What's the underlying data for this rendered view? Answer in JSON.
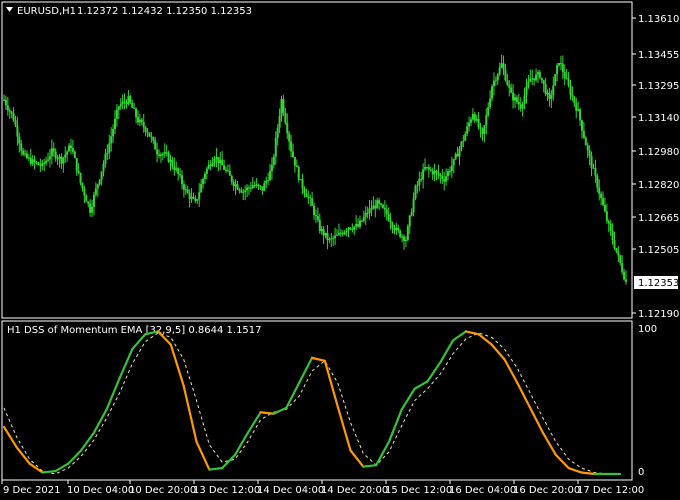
{
  "header": {
    "symbol": "EURUSD,H1",
    "ohlc": "1.12372 1.12432 1.12350 1.12353",
    "menu_icon": "triangle-down-icon"
  },
  "price_axis": {
    "ticks": [
      "1.13610",
      "1.13455",
      "1.13295",
      "1.13140",
      "1.12980",
      "1.12820",
      "1.12665",
      "1.12505",
      "1.12190"
    ],
    "current": "1.12353"
  },
  "indicator": {
    "title": "H1 DSS of Momentum EMA [32,9,5] 0.8644 1.1517",
    "ticks": [
      "100",
      "0"
    ]
  },
  "time_axis": {
    "labels": [
      "9 Dec 2021",
      "10 Dec 04:00",
      "10 Dec 20:00",
      "13 Dec 12:00",
      "14 Dec 04:00",
      "14 Dec 20:00",
      "15 Dec 12:00",
      "16 Dec 04:00",
      "16 Dec 20:00",
      "17 Dec 12:00"
    ]
  },
  "colors": {
    "background": "#000000",
    "frame": "#ffffff",
    "candle": "#33d633",
    "price_label_bg": "#ffffff",
    "signal_green": "#36c236",
    "signal_orange": "#ff9900",
    "dashed": "#f0e6c0"
  },
  "chart_data": {
    "type": "line",
    "price": {
      "close": [
        1.1323,
        1.1314,
        1.1296,
        1.1293,
        1.1291,
        1.1298,
        1.1294,
        1.1301,
        1.1283,
        1.127,
        1.1286,
        1.1302,
        1.132,
        1.1323,
        1.1313,
        1.1308,
        1.1298,
        1.1296,
        1.1289,
        1.1279,
        1.1273,
        1.1288,
        1.1296,
        1.129,
        1.1283,
        1.1279,
        1.1282,
        1.128,
        1.129,
        1.1323,
        1.1299,
        1.1283,
        1.1274,
        1.1261,
        1.1255,
        1.1258,
        1.1262,
        1.1262,
        1.1269,
        1.1273,
        1.1268,
        1.126,
        1.1256,
        1.128,
        1.129,
        1.1288,
        1.1285,
        1.1293,
        1.1304,
        1.1317,
        1.1305,
        1.133,
        1.134,
        1.1325,
        1.132,
        1.1333,
        1.1335,
        1.1322,
        1.1342,
        1.1329,
        1.1317,
        1.1298,
        1.1282,
        1.1265,
        1.125,
        1.12353
      ],
      "ylim": [
        1.1219,
        1.1369
      ]
    },
    "oscillator": {
      "series": [
        {
          "values": [
            32,
            18,
            7,
            1,
            2,
            7,
            16,
            28,
            44,
            65,
            85,
            95,
            97,
            88,
            60,
            22,
            3,
            4,
            13,
            28,
            42,
            41,
            45,
            62,
            79,
            77,
            46,
            16,
            5,
            6,
            22,
            44,
            58,
            63,
            76,
            91,
            97,
            95,
            88,
            78,
            62,
            45,
            28,
            13,
            4,
            1,
            0,
            0,
            0
          ]
        },
        {
          "values": [
            45,
            25,
            10,
            2,
            0,
            4,
            12,
            23,
            38,
            55,
            75,
            90,
            96,
            93,
            78,
            50,
            20,
            8,
            10,
            22,
            37,
            42,
            44,
            53,
            70,
            77,
            62,
            35,
            14,
            6,
            15,
            33,
            50,
            58,
            68,
            82,
            92,
            96,
            93,
            85,
            72,
            55,
            38,
            22,
            10,
            4,
            1,
            0,
            0
          ]
        }
      ],
      "ylim": [
        0,
        100
      ]
    }
  }
}
